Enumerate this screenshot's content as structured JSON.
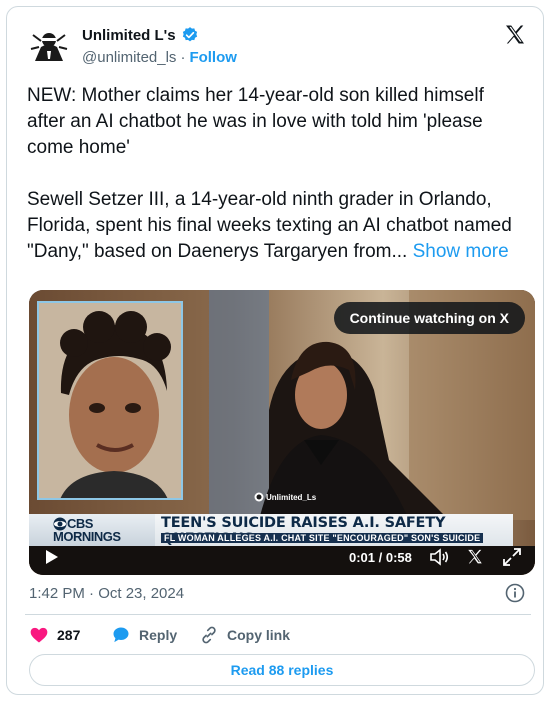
{
  "author": {
    "display_name": "Unlimited L's",
    "handle": "@unlimited_ls",
    "separator": "·",
    "follow_label": "Follow"
  },
  "tweet": {
    "paragraph1": "NEW: Mother claims her 14-year-old son killed himself after an AI chatbot he was in love with told him 'please come home'",
    "paragraph2": "Sewell Setzer III, a 14-year-old ninth grader in Orlando, Florida, spent his final weeks texting an AI chatbot named \"Dany,\" based on Daenerys Targaryen from...",
    "show_more_label": "Show more"
  },
  "video": {
    "continue_label": "Continue watching on X",
    "watermark": "Unlimited_Ls",
    "brand_line1": "CBS",
    "brand_line2": "MORNINGS",
    "headline": "TEEN'S SUICIDE RAISES A.I. SAFETY QUESTIONS",
    "subheadline": "FL WOMAN ALLEGES A.I. CHAT SITE \"ENCOURAGED\" SON'S SUICIDE",
    "time": "0:01 / 0:58"
  },
  "meta": {
    "timestamp": "1:42 PM · Oct 23, 2024"
  },
  "actions": {
    "likes": "287",
    "reply_label": "Reply",
    "copy_link_label": "Copy link"
  },
  "read_replies_label": "Read 88 replies",
  "colors": {
    "accent": "#1d9bf0",
    "like": "#f91880",
    "text": "#0f1419",
    "muted": "#536471",
    "border": "#cfd9de"
  },
  "icons": [
    "verified-badge-icon",
    "x-logo-icon",
    "play-icon",
    "volume-icon",
    "x-small-icon",
    "expand-icon",
    "info-icon",
    "heart-icon",
    "reply-bubble-icon",
    "link-icon"
  ]
}
